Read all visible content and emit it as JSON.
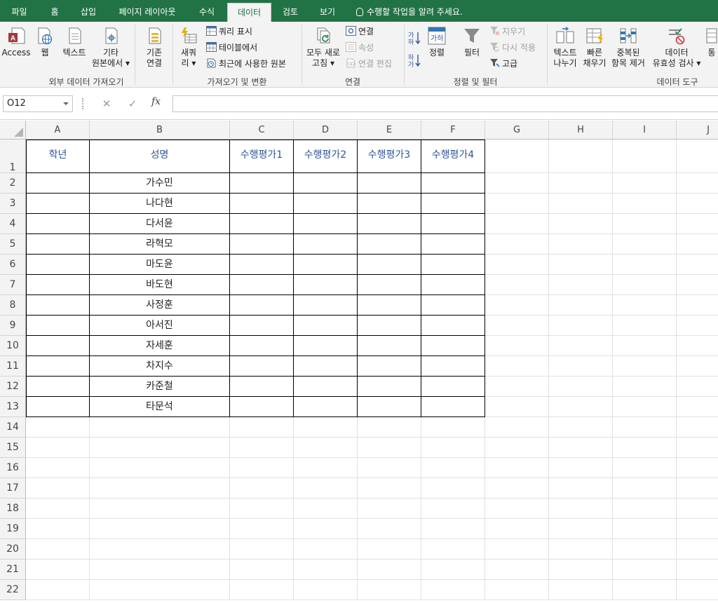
{
  "tabs": [
    {
      "label": "파일",
      "active": false
    },
    {
      "label": "홈",
      "active": false
    },
    {
      "label": "삽입",
      "active": false
    },
    {
      "label": "페이지 레이아웃",
      "active": false
    },
    {
      "label": "수식",
      "active": false
    },
    {
      "label": "데이터",
      "active": true
    },
    {
      "label": "검토",
      "active": false
    },
    {
      "label": "보기",
      "active": false
    }
  ],
  "tellme": "수행할 작업을 알려 주세요.",
  "ribbon": {
    "ext": {
      "access": "Access",
      "web": "웹",
      "text": "텍스트",
      "other1": "기타",
      "other2": "원본에서",
      "label": "외부 데이터 가져오기"
    },
    "conn_existing": {
      "l1": "기존",
      "l2": "연결"
    },
    "getxf": {
      "newq1": "새쿼",
      "newq2": "리",
      "show": "쿼리 표시",
      "table": "테이블에서",
      "recent": "최근에 사용한 원본",
      "label": "가져오기 및 변환"
    },
    "conn": {
      "refresh1": "모두 새로",
      "refresh2": "고침",
      "links": "연결",
      "props": "속성",
      "edit": "연결 편집",
      "label": "연결"
    },
    "sort": {
      "sort": "정렬",
      "filter": "필터",
      "clear": "지우기",
      "reapply": "다시 적용",
      "advanced": "고급",
      "label": "정렬 및 필터"
    },
    "tools": {
      "ttc1": "텍스트",
      "ttc2": "나누기",
      "flash1": "빠른",
      "flash2": "채우기",
      "dup1": "중복된",
      "dup2": "항목 제거",
      "valid1": "데이터",
      "valid2": "유효성 검사",
      "more": "통",
      "label": "데이터 도구"
    }
  },
  "formula": {
    "namebox": "O12",
    "value": ""
  },
  "columns": [
    "A",
    "B",
    "C",
    "D",
    "E",
    "F",
    "G",
    "H",
    "I",
    "J"
  ],
  "rows": [
    "1",
    "2",
    "3",
    "4",
    "5",
    "6",
    "7",
    "8",
    "9",
    "10",
    "11",
    "12",
    "13",
    "14",
    "15",
    "16",
    "17",
    "18",
    "19",
    "20",
    "21",
    "22"
  ],
  "table": {
    "headers": [
      "학년",
      "성명",
      "수행평가1",
      "수행평가2",
      "수행평가3",
      "수행평가4"
    ],
    "names": [
      "가수민",
      "나다현",
      "다서윤",
      "라혁모",
      "마도윤",
      "바도현",
      "사정훈",
      "아서진",
      "자세훈",
      "차지수",
      "카준철",
      "타문석"
    ]
  },
  "colors": {
    "accent": "#217346",
    "header_text": "#2f5597"
  }
}
